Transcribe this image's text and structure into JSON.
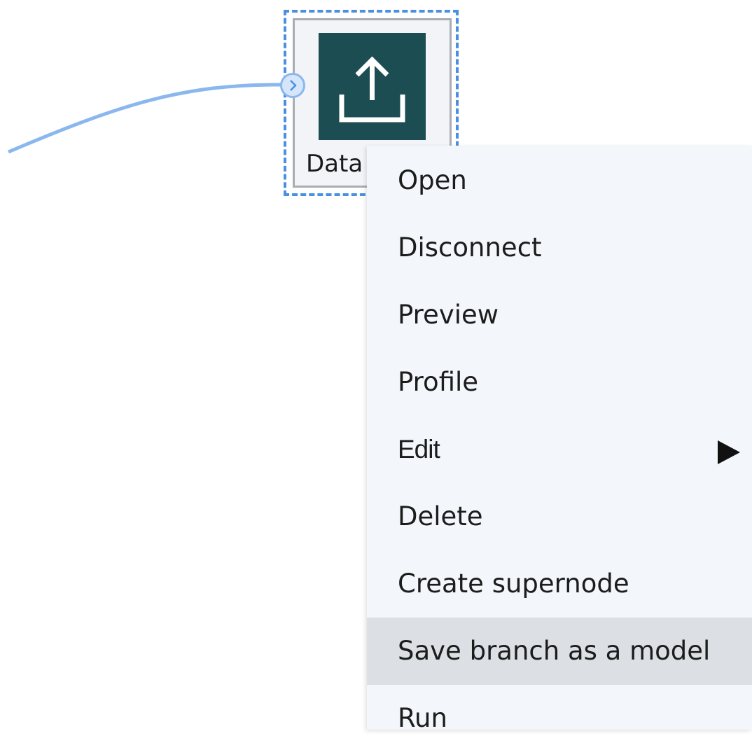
{
  "canvas": {
    "node": {
      "label": "Data",
      "icon": "upload-icon",
      "icon_bg_color": "#1b4d52",
      "selection_color": "#4a90e2"
    },
    "link_color": "#8ab8ee"
  },
  "context_menu": {
    "items": [
      {
        "label": "Open"
      },
      {
        "label": "Disconnect"
      },
      {
        "label": "Preview"
      },
      {
        "label": "Profile"
      },
      {
        "label": "Edit",
        "has_submenu": true
      },
      {
        "label": "Delete"
      },
      {
        "label": "Create supernode"
      },
      {
        "label": "Save branch as a model",
        "hovered": true
      },
      {
        "label": "Run"
      }
    ]
  }
}
